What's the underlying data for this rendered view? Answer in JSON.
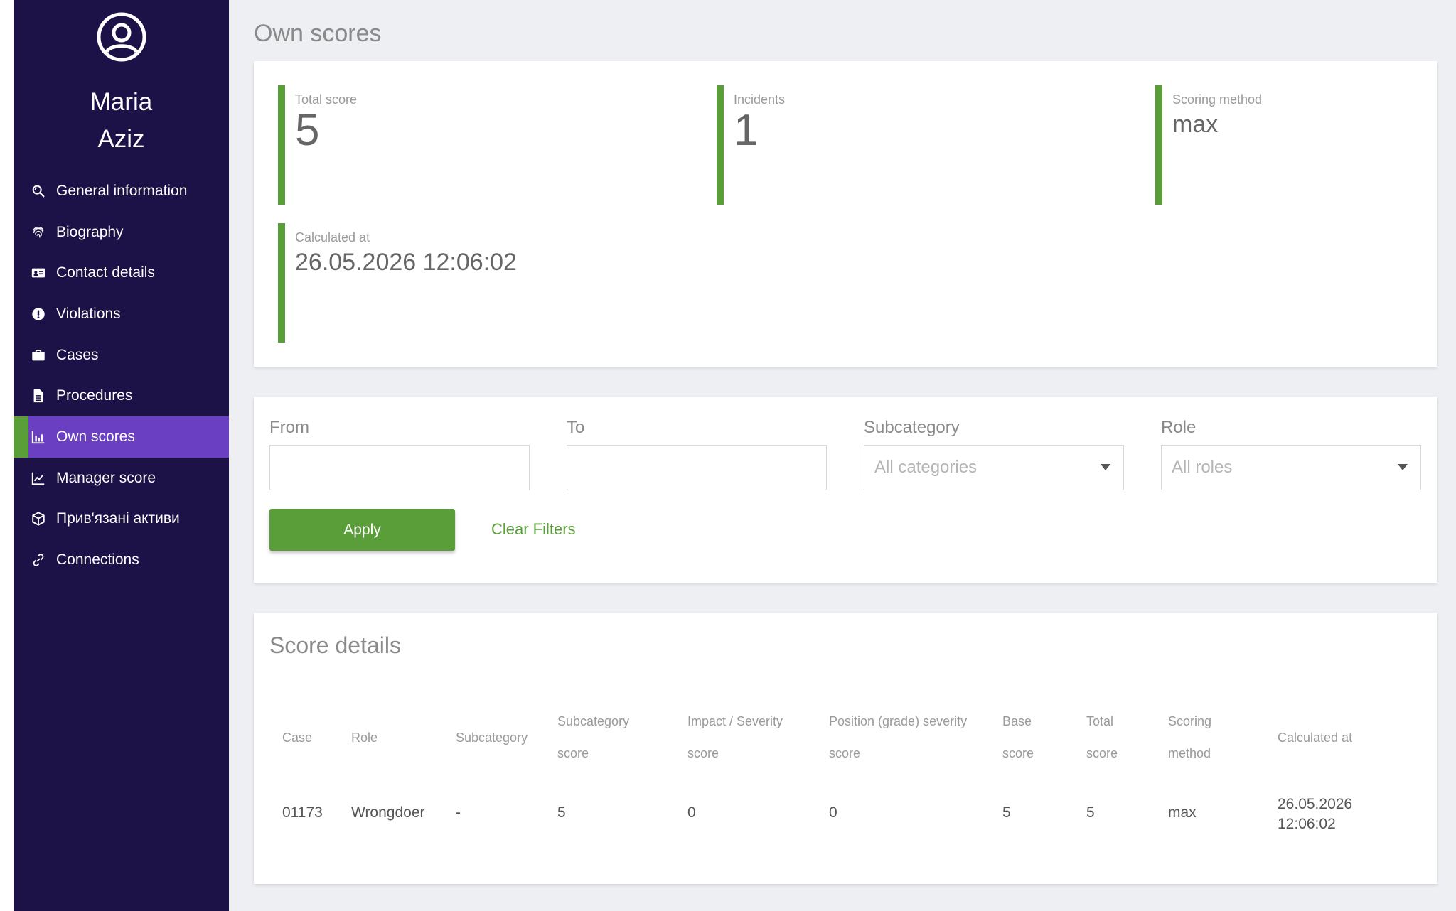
{
  "user": {
    "first_name": "Maria",
    "last_name": "Aziz"
  },
  "nav": [
    {
      "label": "General information",
      "icon": "search-refresh-icon"
    },
    {
      "label": "Biography",
      "icon": "fingerprint-icon"
    },
    {
      "label": "Contact details",
      "icon": "id-card-icon"
    },
    {
      "label": "Violations",
      "icon": "exclamation-icon"
    },
    {
      "label": "Cases",
      "icon": "briefcase-icon"
    },
    {
      "label": "Procedures",
      "icon": "document-icon"
    },
    {
      "label": "Own scores",
      "icon": "bar-chart-icon",
      "active": true
    },
    {
      "label": "Manager score",
      "icon": "line-chart-icon"
    },
    {
      "label": "Прив'язані активи",
      "icon": "cube-icon"
    },
    {
      "label": "Connections",
      "icon": "link-icon"
    }
  ],
  "page_title": "Own scores",
  "summary": {
    "total_score_label": "Total score",
    "total_score_value": "5",
    "incidents_label": "Incidents",
    "incidents_value": "1",
    "scoring_method_label": "Scoring method",
    "scoring_method_value": "max",
    "calculated_at_label": "Calculated at",
    "calculated_at_value": "26.05.2026 12:06:02"
  },
  "filters": {
    "from_label": "From",
    "from_value": "",
    "to_label": "To",
    "to_value": "",
    "subcategory_label": "Subcategory",
    "subcategory_value": "All categories",
    "role_label": "Role",
    "role_value": "All roles",
    "apply_label": "Apply",
    "clear_label": "Clear Filters"
  },
  "details": {
    "title": "Score details",
    "headers": {
      "case": "Case",
      "role": "Role",
      "subcategory": "Subcategory",
      "subcategory_score_1": "Subcategory",
      "subcategory_score_2": "score",
      "impact_1": "Impact / Severity",
      "impact_2": "score",
      "position_1": "Position (grade) severity",
      "position_2": "score",
      "base_1": "Base",
      "base_2": "score",
      "total_1": "Total",
      "total_2": "score",
      "method_1": "Scoring",
      "method_2": "method",
      "calculated_at": "Calculated at"
    },
    "rows": [
      {
        "case": "01173",
        "role": "Wrongdoer",
        "subcategory": "-",
        "subcategory_score": "5",
        "impact_score": "0",
        "position_score": "0",
        "base_score": "5",
        "total_score": "5",
        "scoring_method": "max",
        "calculated_date": "26.05.2026",
        "calculated_time": "12:06:02"
      }
    ]
  },
  "colors": {
    "sidebar_bg": "#1c1248",
    "active_item_bg": "#6b3fc2",
    "accent_green": "#5a9e3a",
    "page_bg": "#eeeff3"
  }
}
